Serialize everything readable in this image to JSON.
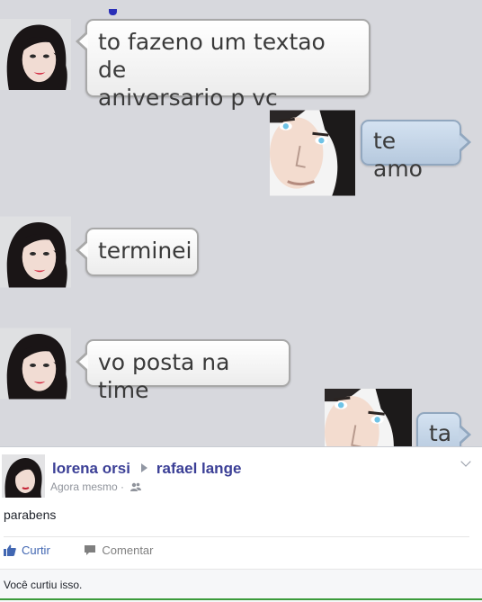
{
  "messages": [
    {
      "direction": "in",
      "text_lines": [
        "to fazeno um textao de",
        "aniversario p vc"
      ]
    },
    {
      "direction": "out",
      "text": "te amo"
    },
    {
      "direction": "in",
      "text": "terminei"
    },
    {
      "direction": "in",
      "text": "vo posta na time"
    },
    {
      "direction": "out",
      "text": "ta"
    }
  ],
  "post": {
    "author": "lorena orsi",
    "recipient": "rafael lange",
    "time": "Agora mesmo",
    "text": "parabens",
    "actions": {
      "like": "Curtir",
      "comment": "Comentar"
    },
    "like_status": "Você curtiu isso.",
    "icons": {
      "audience": "friends-icon",
      "like": "thumbs-up-icon",
      "comment": "comment-icon",
      "menu": "chevron-down-icon"
    }
  },
  "colors": {
    "background": "#d7d8dd",
    "outgoing_bubble": "#c4d4e6",
    "name_link": "#3b3f96"
  }
}
